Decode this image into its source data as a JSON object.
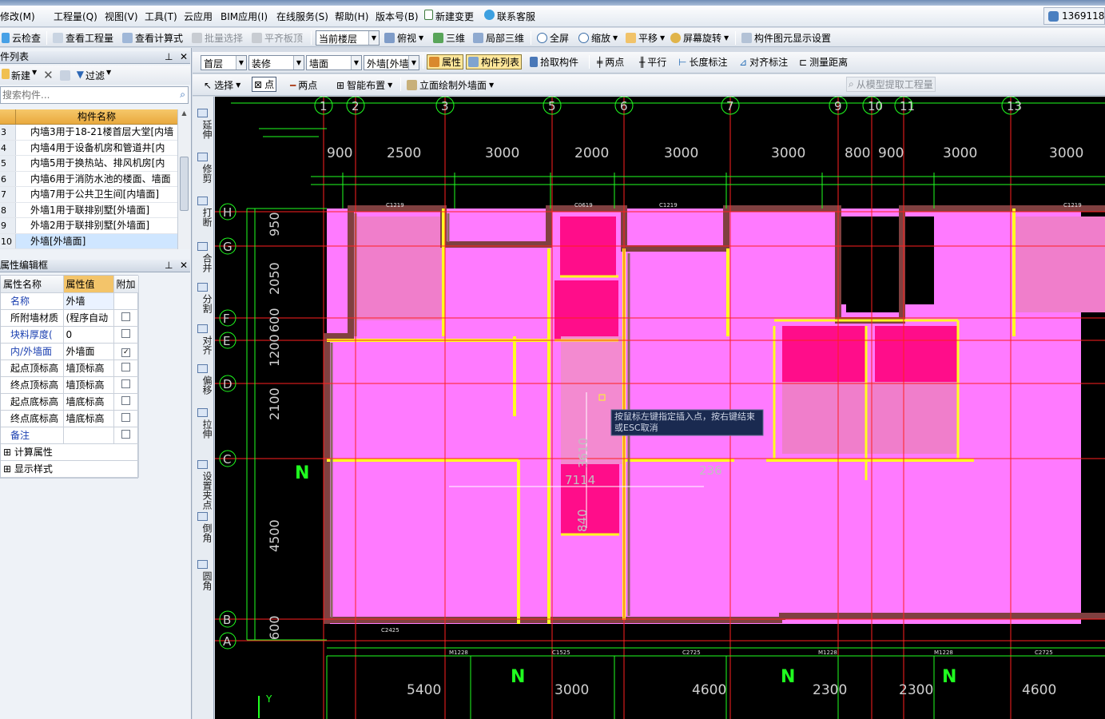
{
  "phone": "1369118",
  "menu": [
    "修改(M)",
    "工程量(Q)",
    "视图(V)",
    "工具(T)",
    "云应用",
    "BIM应用(I)",
    "在线服务(S)",
    "帮助(H)",
    "版本号(B)",
    "新建变更",
    "联系客服"
  ],
  "toolbar1": {
    "cloud_check": "云检查",
    "view_project": "查看工程量",
    "view_formula": "查看计算式",
    "batch_select": "批量选择",
    "align_top": "平齐板顶",
    "floor_scope": "当前楼层",
    "top_view": "俯视",
    "three_d": "三维",
    "local_3d": "局部三维",
    "fullscreen": "全屏",
    "zoom": "缩放",
    "pan": "平移",
    "rotate": "屏幕旋转",
    "display_settings": "构件图元显示设置"
  },
  "toolbar2": {
    "floor": "首层",
    "category": "装修",
    "type": "墙面",
    "element": "外墙[外墙",
    "attribute": "属性",
    "component_list": "构件列表",
    "pick": "拾取构件",
    "two_points": "两点",
    "parallel": "平行",
    "length_dim": "长度标注",
    "align_dim": "对齐标注",
    "measure": "测量距离"
  },
  "toolbar3": {
    "select": "选择",
    "point": "点",
    "two_points": "两点",
    "smart_layout": "智能布置",
    "elevation_draw": "立面绘制外墙面",
    "extract": "从模型提取工程量"
  },
  "component_panel": {
    "title": "件列表",
    "new": "新建",
    "filter": "过滤",
    "search_placeholder": "搜索构件...",
    "col_name": "构件名称",
    "rows": [
      {
        "n": "3",
        "name": "内墙3用于18-21楼首层大堂[内墙"
      },
      {
        "n": "4",
        "name": "内墙4用于设备机房和管道井[内"
      },
      {
        "n": "5",
        "name": "内墙5用于换热站、排风机房[内"
      },
      {
        "n": "6",
        "name": "内墙6用于消防水池的楼面、墙面"
      },
      {
        "n": "7",
        "name": "内墙7用于公共卫生间[内墙面]"
      },
      {
        "n": "8",
        "name": "外墙1用于联排别墅[外墙面]"
      },
      {
        "n": "9",
        "name": "外墙2用于联排别墅[外墙面]"
      },
      {
        "n": "10",
        "name": "外墙[外墙面]"
      }
    ]
  },
  "property_panel": {
    "title": "属性编辑框",
    "col_name": "属性名称",
    "col_value": "属性值",
    "col_extra": "附加",
    "rows": [
      {
        "name": "名称",
        "value": "外墙",
        "check": "",
        "blue": true
      },
      {
        "name": "所附墙材质",
        "value": "(程序自动",
        "check": "off",
        "blue": false
      },
      {
        "name": "块料厚度(",
        "value": "0",
        "check": "off",
        "blue": true
      },
      {
        "name": "内/外墙面",
        "value": "外墙面",
        "check": "on",
        "blue": true
      },
      {
        "name": "起点顶标高",
        "value": "墙顶标高",
        "check": "off",
        "blue": false
      },
      {
        "name": "终点顶标高",
        "value": "墙顶标高",
        "check": "off",
        "blue": false
      },
      {
        "name": "起点底标高",
        "value": "墙底标高",
        "check": "off",
        "blue": false
      },
      {
        "name": "终点底标高",
        "value": "墙底标高",
        "check": "off",
        "blue": false
      },
      {
        "name": "备注",
        "value": "",
        "check": "off",
        "blue": true
      }
    ],
    "groups": [
      "计算属性",
      "显示样式"
    ]
  },
  "vertical_tools": [
    "延伸",
    "修剪",
    "打断",
    "合并",
    "分割",
    "对齐",
    "偏移",
    "拉伸",
    "设置夹点",
    "倒角",
    "圆角"
  ],
  "drawing": {
    "axis_top": [
      "1",
      "2",
      "3",
      "5",
      "6",
      "7",
      "9",
      "10",
      "11",
      "13"
    ],
    "axis_left": [
      "H",
      "G",
      "F",
      "E",
      "D",
      "C",
      "B",
      "A"
    ],
    "dims_top": [
      "900",
      "2500",
      "3000",
      "2000",
      "3000",
      "3000",
      "800",
      "900",
      "3000",
      "3000"
    ],
    "dims_bottom": [
      "5400",
      "3000",
      "4600",
      "2300",
      "2300",
      "4600"
    ],
    "dims_left": [
      "950",
      "2050",
      "600",
      "1200",
      "2100",
      "4500",
      "600"
    ],
    "door_labels": [
      "C1219",
      "C0619",
      "C1219",
      "C1219",
      "C2425",
      "M1228",
      "C1525",
      "C2725",
      "M1228",
      "M1228",
      "C2725"
    ],
    "tooltip": "按鼠标左键指定插入点，按右键结束或ESC取消",
    "measure_vertical": "3610",
    "measure_horizontal": "7114",
    "measure_small": "236",
    "measure_low": "840",
    "north": "N",
    "y_axis": "Y",
    "colors": {
      "canvas": "#000000",
      "room": "#ff7aff",
      "room_dark": "#ff0d8a",
      "wall": "#804040",
      "yellow": "#ffff20",
      "green": "#20ff20",
      "red_axis": "#ff2020"
    }
  }
}
